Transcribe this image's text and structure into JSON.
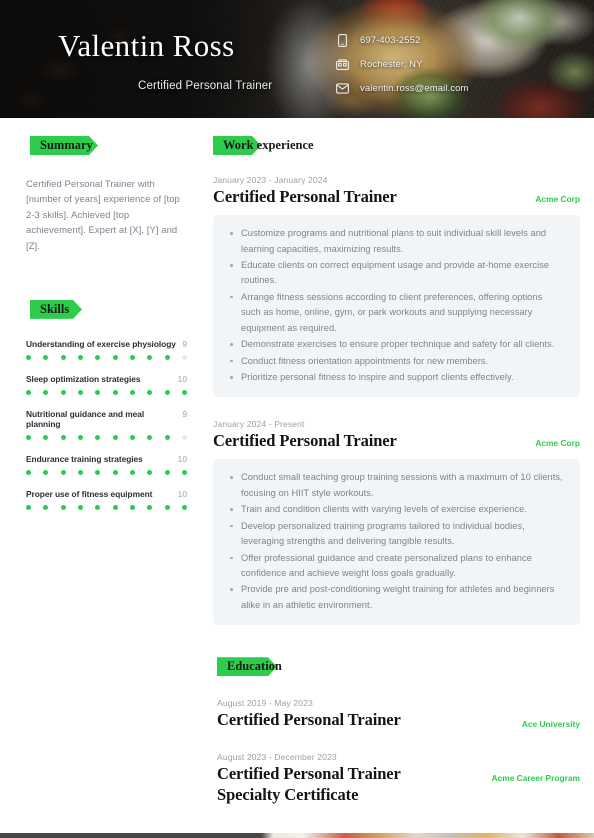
{
  "header": {
    "name": "Valentin Ross",
    "job_title": "Certified Personal Trainer",
    "contacts": [
      {
        "icon": "phone-icon",
        "value": "697-403-2552"
      },
      {
        "icon": "location-icon",
        "value": "Rochester, NY"
      },
      {
        "icon": "email-icon",
        "value": "valentin.ross@email.com"
      }
    ]
  },
  "sidebar": {
    "summary": {
      "heading": "Summary",
      "text": "Certified Personal Trainer with [number of years] experience of [top 2-3 skills]. Achieved [top achievement]. Expert at [X], [Y] and [Z]."
    },
    "skills": {
      "heading": "Skills",
      "max": 10,
      "items": [
        {
          "name": "Understanding of exercise physiology",
          "score": 9
        },
        {
          "name": "Sleep optimization strategies",
          "score": 10
        },
        {
          "name": "Nutritional guidance and meal planning",
          "score": 9
        },
        {
          "name": "Endurance training strategies",
          "score": 10
        },
        {
          "name": "Proper use of fitness equipment",
          "score": 10
        }
      ]
    }
  },
  "main": {
    "work": {
      "heading": "Work experience",
      "entries": [
        {
          "date": "January 2023 - January 2024",
          "role": "Certified Personal Trainer",
          "org": "Acme Corp",
          "bullets": [
            "Customize programs and nutritional plans to suit individual skill levels and learning capacities, maximizing results.",
            "Educate clients on correct equipment usage and provide at-home exercise routines.",
            "Arrange fitness sessions according to client preferences, offering options such as home, online, gym, or park workouts and supplying necessary equipment as required.",
            "Demonstrate exercises to ensure proper technique and safety for all clients.",
            "Conduct fitness orientation appointments for new members.",
            "Prioritize personal fitness to inspire and support clients effectively."
          ]
        },
        {
          "date": "January 2024 - Present",
          "role": "Certified Personal Trainer",
          "org": "Acme Corp",
          "bullets": [
            "Conduct small teaching group training sessions with a maximum of 10 clients, focusing on HIIT style workouts.",
            "Train and condition clients with varying levels of exercise experience.",
            "Develop personalized training programs tailored to individual bodies, leveraging strengths and delivering tangible results.",
            "Offer professional guidance and create personalized plans to enhance confidence and achieve weight loss goals gradually.",
            "Provide pre and post-conditioning weight training for athletes and beginners alike in an athletic environment."
          ]
        }
      ]
    },
    "education": {
      "heading": "Education",
      "entries": [
        {
          "date": "August 2019 - May 2023",
          "degree": "Certified Personal Trainer",
          "org": "Ace University"
        },
        {
          "date": "August 2023 - December 2023",
          "degree": "Certified Personal Trainer Specialty Certificate",
          "org": "Acme Career Program"
        }
      ]
    }
  },
  "theme": {
    "accent_green": "#2ECC4B",
    "card_background": "#f2f5f7",
    "body_text": "#7d8490",
    "heading_text": "#141414"
  }
}
